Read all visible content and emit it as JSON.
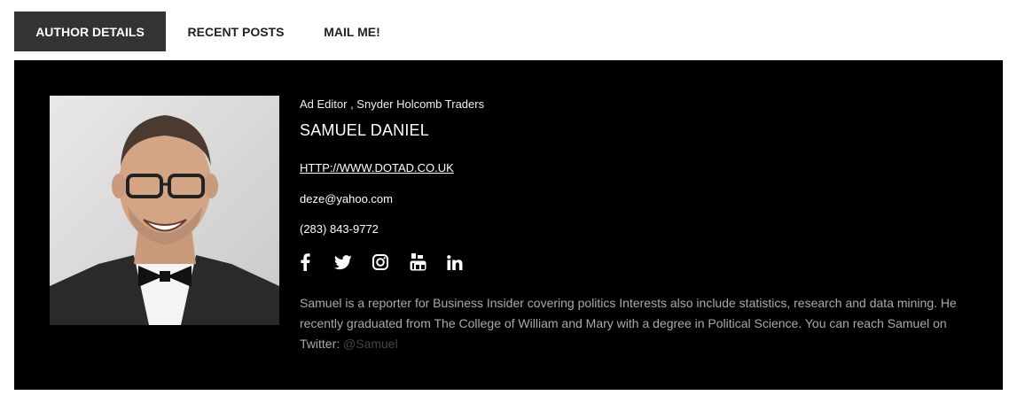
{
  "tabs": [
    {
      "label": "AUTHOR DETAILS",
      "active": true
    },
    {
      "label": "RECENT POSTS",
      "active": false
    },
    {
      "label": "MAIL ME!",
      "active": false
    }
  ],
  "author": {
    "role": "Ad Editor , Snyder Holcomb Traders",
    "name": "SAMUEL DANIEL",
    "website": "HTTP://WWW.DOTAD.CO.UK",
    "email": "deze@yahoo.com",
    "phone": "(283) 843-9772",
    "bio": "Samuel is a reporter for Business Insider covering politics Interests also include statistics, research and data mining. He recently graduated from The College of William and Mary with a degree in Political Science. You can reach Samuel on Twitter: ",
    "twitter_handle": "@Samuel"
  },
  "socials": [
    {
      "icon": "facebook-icon"
    },
    {
      "icon": "twitter-icon"
    },
    {
      "icon": "instagram-icon"
    },
    {
      "icon": "youtube-icon"
    },
    {
      "icon": "linkedin-icon"
    }
  ],
  "colors": {
    "panel_bg": "#000000",
    "active_tab_bg": "#333333",
    "bio_text": "#aaaaaa",
    "twitter_handle": "#444444"
  }
}
